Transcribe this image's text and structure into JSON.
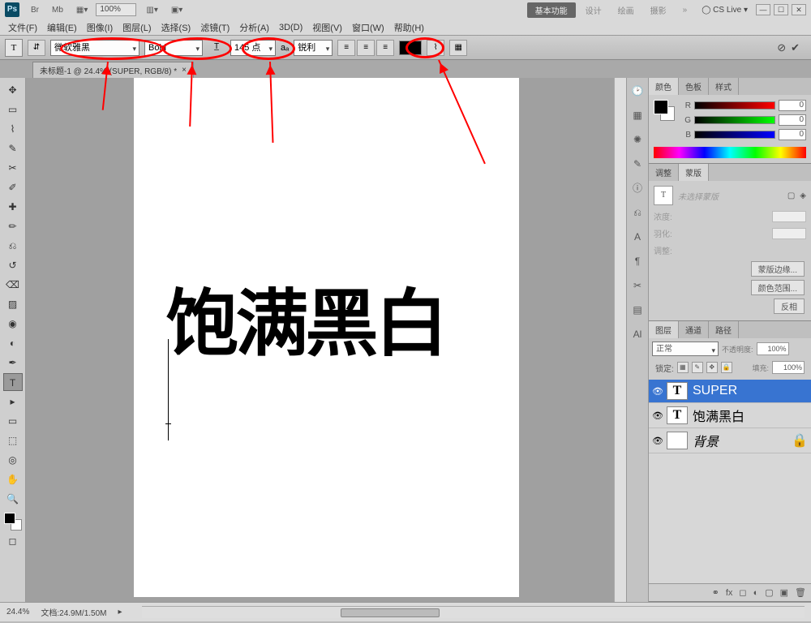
{
  "title": {
    "zoom": "100%"
  },
  "workspace": {
    "basic": "基本功能",
    "design": "设计",
    "paint": "绘画",
    "photo": "摄影",
    "cslive": "CS Live"
  },
  "menu": {
    "file": "文件(F)",
    "edit": "编辑(E)",
    "image": "图像(I)",
    "layer": "图层(L)",
    "select": "选择(S)",
    "filter": "滤镜(T)",
    "analysis": "分析(A)",
    "threeD": "3D(D)",
    "view": "视图(V)",
    "window": "窗口(W)",
    "help": "帮助(H)"
  },
  "options": {
    "font": "微软雅黑",
    "style": "Bold",
    "size": "145 点",
    "aa": "锐利",
    "aa_lbl": "aₐ"
  },
  "doc": {
    "tab": "未标题-1 @ 24.4% (SUPER, RGB/8) *"
  },
  "canvas": {
    "text": "饱满黑白"
  },
  "panels": {
    "color": {
      "tab1": "颜色",
      "tab2": "色板",
      "tab3": "样式",
      "r": "R",
      "g": "G",
      "b": "B",
      "rv": "0",
      "gv": "0",
      "bv": "0"
    },
    "adjust": {
      "tab1": "调整",
      "tab2": "蒙版",
      "noMask": "未选择蒙版",
      "density": "浓度:",
      "feather": "羽化:",
      "refine": "调整:",
      "edge": "蒙版边缘...",
      "range": "颜色范围...",
      "invert": "反相"
    },
    "layers": {
      "tab1": "图层",
      "tab2": "通道",
      "tab3": "路径",
      "blend": "正常",
      "opacityLbl": "不透明度:",
      "opacity": "100%",
      "lockLbl": "锁定:",
      "fillLbl": "填充:",
      "fill": "100%",
      "l1": "SUPER",
      "l2": "饱满黑白",
      "l3": "背景"
    }
  },
  "status": {
    "zoom": "24.4%",
    "doc": "文档:24.9M/1.50M"
  }
}
